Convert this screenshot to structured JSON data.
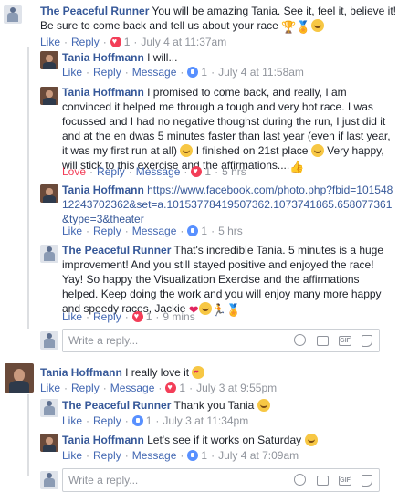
{
  "actions": {
    "like": "Like",
    "reply": "Reply",
    "message": "Message",
    "love": "Love"
  },
  "comments": [
    {
      "author": "The Peaceful Runner",
      "text": " You will be amazing Tania. See it, feel it, believe it! Be sure to come back and tell us about your race ",
      "reaction_icon": "love",
      "reaction_count": "1",
      "time": "July 4 at 11:37am",
      "emoji": [
        "trophy",
        "medal",
        "smile"
      ]
    },
    {
      "author": "Tania Hoffmann",
      "text": " I will...",
      "reaction_icon": "like",
      "reaction_count": "1",
      "time": "July 4 at 11:58am"
    },
    {
      "author": "Tania Hoffmann",
      "text_1": " I promised to come back, and really, I am convinced it helped me through a tough and very hot race. I was focussed and I had no negative thoughst during the run, I just did it and at the en dwas 5 minutes faster than last year (even if last year, it was my first run at all) ",
      "text_2": " I finished on 21st place ",
      "text_3": " Very happy, will stick to this exercise and the affirmations....",
      "reaction_icon": "love",
      "reaction_count": "1",
      "time": "5 hrs",
      "liked_label": "Love"
    },
    {
      "author": "Tania Hoffmann",
      "link": "https://www.facebook.com/photo.php?fbid=10154812243702362&set=a.10153778419507362.1073741865.658077361&type=3&theater",
      "reaction_icon": "like",
      "reaction_count": "1",
      "time": "5 hrs"
    },
    {
      "author": "The Peaceful Runner",
      "text": " That's incredible Tania. 5 minutes is a huge improvement! And you still stayed positive and enjoyed the race! Yay! So happy the Visualization Exercise and the affirmations helped. Keep doing the work and you will enjoy many more happy and speedy races, Jackie ",
      "reaction_icon": "love",
      "reaction_count": "1",
      "time": "9 mins",
      "emoji": [
        "heart",
        "smile",
        "runner",
        "medal"
      ]
    },
    {
      "author": "Tania Hoffmann",
      "text": " I really love it ",
      "reaction_icon": "love",
      "reaction_count": "1",
      "time": "July 3 at 9:55pm",
      "emoji": [
        "heart-eyes"
      ]
    },
    {
      "author": "The Peaceful Runner",
      "text": " Thank you Tania ",
      "reaction_icon": "like",
      "reaction_count": "1",
      "time": "July 3 at 11:34pm",
      "emoji": [
        "laughing"
      ]
    },
    {
      "author": "Tania Hoffmann",
      "text": " Let's see if it works on Saturday ",
      "reaction_icon": "like",
      "reaction_count": "1",
      "time": "July 4 at 7:09am",
      "emoji": [
        "smile"
      ]
    }
  ],
  "reply_box": {
    "placeholder": "Write a reply...",
    "icons": [
      "emoji-icon",
      "camera-icon",
      "gif-icon",
      "sticker-icon"
    ]
  },
  "reply_box_2": {
    "placeholder": "Write a reply...",
    "icons": [
      "emoji-icon",
      "camera-icon",
      "gif-icon",
      "sticker-icon"
    ]
  },
  "colors": {
    "link": "#365899",
    "action": "#4267b2",
    "meta": "#90949c",
    "love": "#f33e58",
    "like": "#5890ff"
  }
}
